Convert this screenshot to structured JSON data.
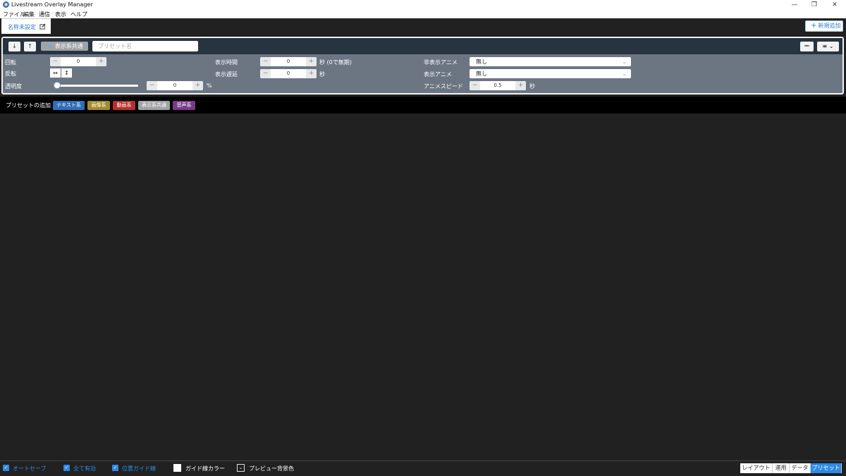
{
  "window": {
    "title": "Livestream Overlay Manager",
    "minimize_glyph": "—",
    "restore_glyph": "❐",
    "close_glyph": "✕"
  },
  "menu": [
    "ファイル",
    "編集",
    "通信",
    "表示",
    "ヘルプ"
  ],
  "tab": {
    "label": "名称未設定"
  },
  "new_button": {
    "label": "新規追加",
    "icon": "plus-icon"
  },
  "preset_panel": {
    "down_glyph": "↓",
    "up_glyph": "↑",
    "common_chip": "表示系共通",
    "name_placeholder": "プリセット名",
    "minus_glyph": "−",
    "menu_glyph": "≡ ⌄",
    "rotation": {
      "label": "回転",
      "value": "0"
    },
    "flip": {
      "label": "反転",
      "h_glyph": "↔",
      "v_glyph": "↕"
    },
    "opacity": {
      "label": "透明度",
      "value": "0",
      "unit": "%",
      "slider_fraction": 0
    },
    "display_time": {
      "label": "表示時間",
      "value": "0",
      "unit": "秒 (0で無期)"
    },
    "display_delay": {
      "label": "表示遅延",
      "value": "0",
      "unit": "秒"
    },
    "hide_anime": {
      "label": "非表示アニメ",
      "value": "無し"
    },
    "show_anime": {
      "label": "表示アニメ",
      "value": "無し"
    },
    "anime_speed": {
      "label": "アニメスピード",
      "value": "0.5",
      "unit": "秒"
    }
  },
  "add_preset": {
    "label": "プリセットの追加",
    "chips": [
      {
        "label": "テキスト系",
        "color": "#2f6db8"
      },
      {
        "label": "画像系",
        "color": "#a38a2c"
      },
      {
        "label": "動画系",
        "color": "#b3302b"
      },
      {
        "label": "表示系共通",
        "color": "#a0a3a6"
      },
      {
        "label": "音声系",
        "color": "#7a3a88"
      }
    ]
  },
  "status": {
    "autosave": "オートセーブ",
    "all_enabled": "全て有効",
    "guide_lines": "位置ガイド線",
    "guide_color": "ガイド線カラー",
    "preview_bg": "プレビュー背景色",
    "check_glyph": "✓"
  },
  "modes": [
    "レイアウト",
    "運用",
    "データ",
    "プリセット"
  ],
  "active_mode": "プリセット"
}
